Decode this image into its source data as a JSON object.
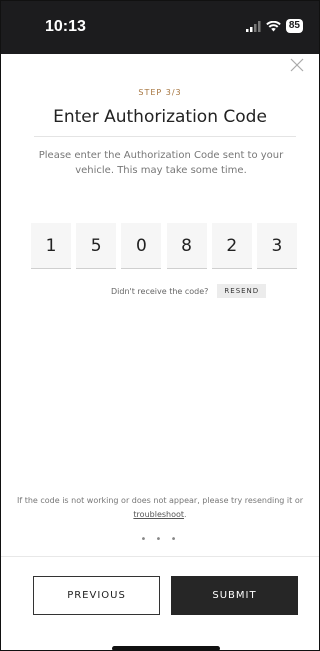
{
  "status_bar": {
    "time": "10:13",
    "battery": "85",
    "signal_icon": "signal-bars-icon",
    "wifi_icon": "wifi-icon"
  },
  "close_icon": "close-icon",
  "step_label": "STEP 3/3",
  "title": "Enter Authorization Code",
  "description": "Please enter the Authorization Code sent to your vehicle. This may take some time.",
  "code_digits": [
    "1",
    "5",
    "0",
    "8",
    "2",
    "3"
  ],
  "resend": {
    "prompt": "Didn't receive the code?",
    "button_label": "RESEND"
  },
  "help": {
    "text_before": "If the code is not working or does not appear, please try resending it or ",
    "link_text": "troubleshoot",
    "text_after": "."
  },
  "pagination_dots": "• • •",
  "buttons": {
    "previous": "PREVIOUS",
    "submit": "SUBMIT"
  },
  "colors": {
    "accent": "#a5743e",
    "submit_bg": "#262626",
    "status_bar_bg": "#1c1c1e"
  }
}
